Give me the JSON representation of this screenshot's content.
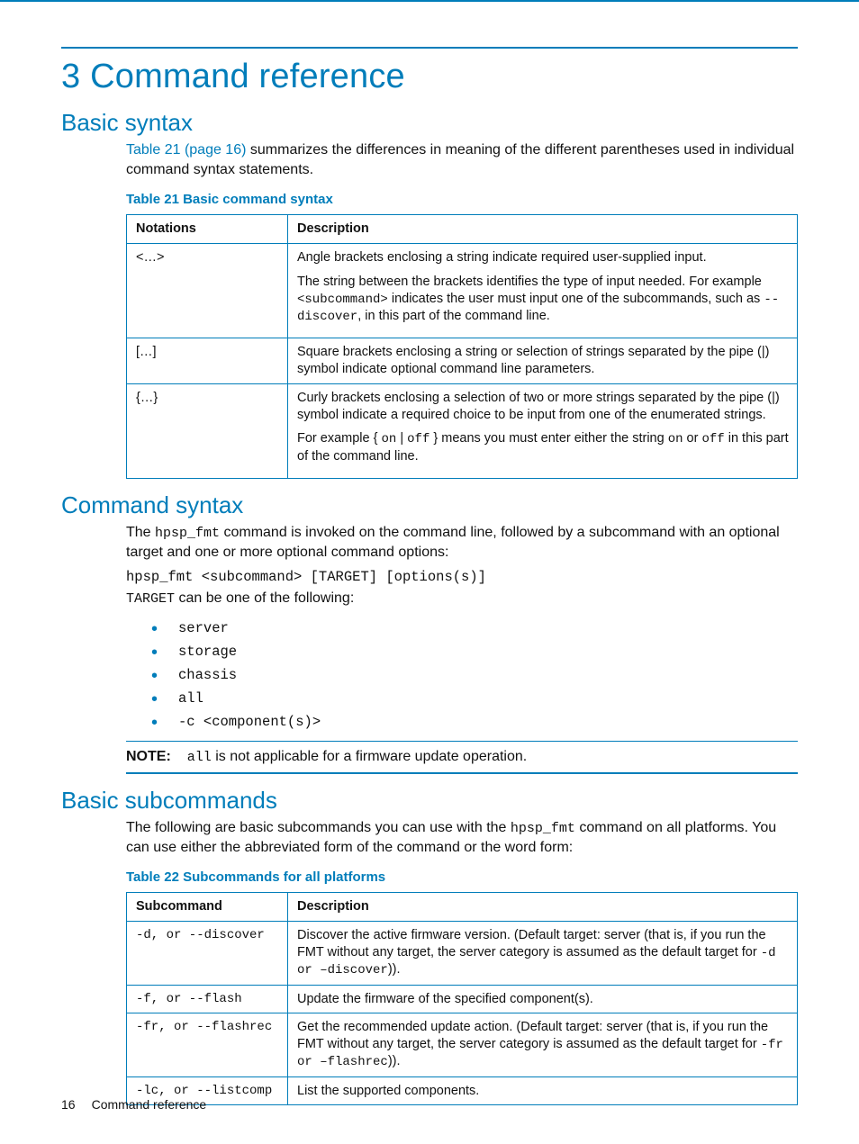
{
  "title": "3 Command reference",
  "sections": {
    "basic_syntax": {
      "heading": "Basic syntax",
      "intro_pre": "Table 21 (page 16)",
      "intro_post": " summarizes the differences in meaning of the different parentheses used in individual command syntax statements.",
      "table_caption": "Table 21 Basic command syntax",
      "table_headers": {
        "c1": "Notations",
        "c2": "Description"
      },
      "rows": [
        {
          "notation": "<…>",
          "p1": "Angle brackets enclosing a string indicate required user-supplied input.",
          "p2a": "The string between the brackets identifies the type of input needed. For example ",
          "p2code1": "<subcommand>",
          "p2b": " indicates the user must input one of the subcommands, such as ",
          "p2code2": "--discover",
          "p2c": ", in this part of the command line."
        },
        {
          "notation": "[…]",
          "p1": "Square brackets enclosing a string or selection of strings separated by the pipe (|) symbol indicate optional command line parameters."
        },
        {
          "notation": "{…}",
          "p1": "Curly brackets enclosing a selection of two or more strings separated by the pipe (|) symbol indicate a required choice to be input from one of the enumerated strings.",
          "p2a": "For example { ",
          "p2code1": "on",
          "p2b": "  |  ",
          "p2code2": "off",
          "p2c": " } means you must enter either the string ",
          "p2code3": "on",
          "p2d": " or ",
          "p2code4": "off",
          "p2e": " in this part of the command line."
        }
      ]
    },
    "command_syntax": {
      "heading": "Command syntax",
      "p1a": "The ",
      "p1code": "hpsp_fmt",
      "p1b": " command is invoked on the command line, followed by a subcommand with an optional target and one or more optional command options:",
      "codeline": "hpsp_fmt <subcommand> [TARGET] [options(s)]",
      "p2code": "TARGET",
      "p2b": " can be one of the following:",
      "targets": [
        "server",
        "storage",
        "chassis",
        "all",
        "-c <component(s)>"
      ],
      "note_label": "NOTE:",
      "note_code": "all",
      "note_text": " is not applicable for a firmware update operation."
    },
    "basic_subcommands": {
      "heading": "Basic subcommands",
      "p1a": "The following are basic subcommands you can use with the ",
      "p1code": "hpsp_fmt",
      "p1b": " command on all platforms. You can use either the abbreviated form of the command or the word form:",
      "table_caption": "Table 22 Subcommands for all platforms",
      "table_headers": {
        "c1": "Subcommand",
        "c2": "Description"
      },
      "rows": [
        {
          "sub": "-d, or --discover",
          "desc_a": "Discover the active firmware version. (Default target: server (that is, if you run the FMT without any target, the server category is assumed as the default target for ",
          "codes": "-d or –discover",
          "desc_b": "))."
        },
        {
          "sub": "-f, or --flash",
          "desc_a": "Update the firmware of the specified component(s)."
        },
        {
          "sub": "-fr, or --flashrec",
          "desc_a": "Get the recommended update action. (Default target: server (that is, if  you run the FMT without any target, the server category is assumed as the default target for  ",
          "codes": "-fr or –flashrec",
          "desc_b": "))."
        },
        {
          "sub": "-lc, or --listcomp",
          "desc_a": "List the supported components."
        }
      ]
    }
  },
  "footer": {
    "page": "16",
    "title": "Command reference"
  }
}
